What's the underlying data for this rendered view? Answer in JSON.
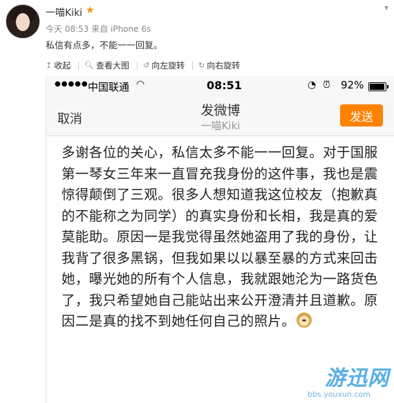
{
  "post": {
    "username": "一喵Kiki",
    "meta": "今天 08:53 来自 iPhone 6s",
    "caption": "私信有点多，不能一一回复。"
  },
  "toolbar": {
    "collapse": "收起",
    "view_large": "查看大图",
    "rotate_left": "向左旋转",
    "rotate_right": "向右旋转"
  },
  "phone": {
    "carrier": "中国联通",
    "time": "08:51",
    "battery": "92%",
    "nav": {
      "cancel": "取消",
      "title": "发微博",
      "subtitle": "一喵Kiki",
      "send": "发送"
    },
    "compose_text": "多谢各位的关心，私信太多不能一一回复。对于国服第一琴女三年来一直冒充我身份的这件事，我也是震惊得颠倒了三观。很多人想知道我这位校友（抱歉真的不能称之为同学）的真实身份和长相，我是真的爱莫能助。原因一是我觉得虽然她盗用了我的身份，让我背了很多黑锅，但我如果以以暴至暴的方式来回击她，曝光她的所有个人信息，我就跟她沦为一路货色了，我只希望她自己能站出来公开澄清并且道歉。原因二是真的找不到她任何自己的照片。"
  },
  "watermark": {
    "logo": "游迅网",
    "url": "bbs.youxun.com"
  },
  "colors": {
    "send_button": "#ff8200",
    "vip_star": "#f29100",
    "watermark": "#3ba2dd"
  },
  "icons": [
    "avatar",
    "vip-star-icon",
    "chevron-down-icon",
    "collapse-icon",
    "search-zoom-icon",
    "rotate-left-icon",
    "rotate-right-icon",
    "wifi-icon",
    "lock-rotation-icon",
    "alarm-icon",
    "battery-icon",
    "doge-emoji-icon"
  ]
}
